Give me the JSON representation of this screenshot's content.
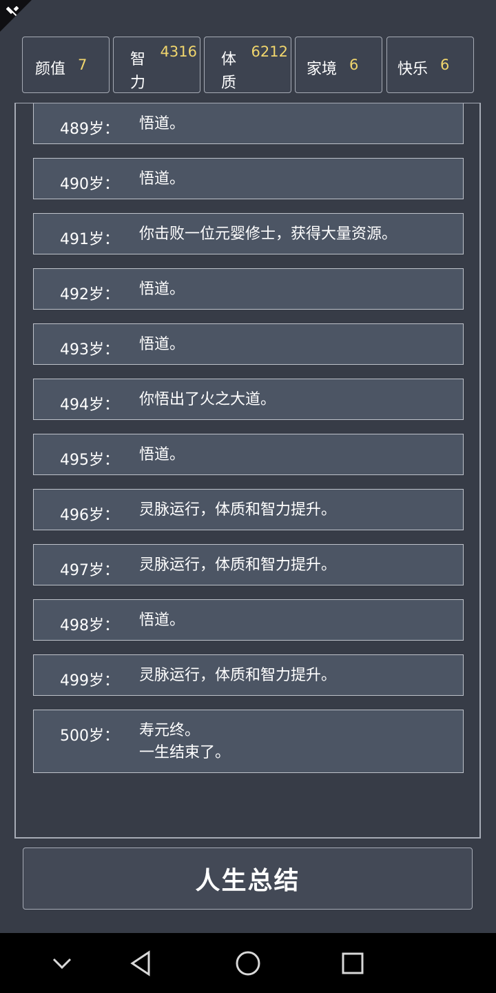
{
  "stats": [
    {
      "label": "颜值",
      "value": "7",
      "layout": "h"
    },
    {
      "label": "智力",
      "label_top": "智",
      "label_bottom": "力",
      "value": "4316",
      "layout": "v"
    },
    {
      "label": "体质",
      "label_top": "体",
      "label_bottom": "质",
      "value": "6212",
      "layout": "v"
    },
    {
      "label": "家境",
      "value": "6",
      "layout": "h"
    },
    {
      "label": "快乐",
      "value": "6",
      "layout": "h"
    }
  ],
  "timeline": [
    {
      "age": "489岁：",
      "text": "悟道。"
    },
    {
      "age": "490岁：",
      "text": "悟道。"
    },
    {
      "age": "491岁：",
      "text": "你击败一位元婴修士，获得大量资源。"
    },
    {
      "age": "492岁：",
      "text": "悟道。"
    },
    {
      "age": "493岁：",
      "text": "悟道。"
    },
    {
      "age": "494岁：",
      "text": "你悟出了火之大道。"
    },
    {
      "age": "495岁：",
      "text": "悟道。"
    },
    {
      "age": "496岁：",
      "text": "灵脉运行，体质和智力提升。"
    },
    {
      "age": "497岁：",
      "text": "灵脉运行，体质和智力提升。"
    },
    {
      "age": "498岁：",
      "text": "悟道。"
    },
    {
      "age": "499岁：",
      "text": "灵脉运行，体质和智力提升。"
    },
    {
      "age": "500岁：",
      "text": "寿元终。",
      "text2": "一生结束了。"
    }
  ],
  "summary_button": "人生总结",
  "navbar": {
    "icons": [
      "chevron-down-icon",
      "back-triangle-icon",
      "home-circle-icon",
      "recents-square-icon"
    ]
  },
  "colors": {
    "background": "#373c47",
    "card": "#4c5564",
    "stat_value": "#f1d66d",
    "border": "#a7acb6"
  }
}
